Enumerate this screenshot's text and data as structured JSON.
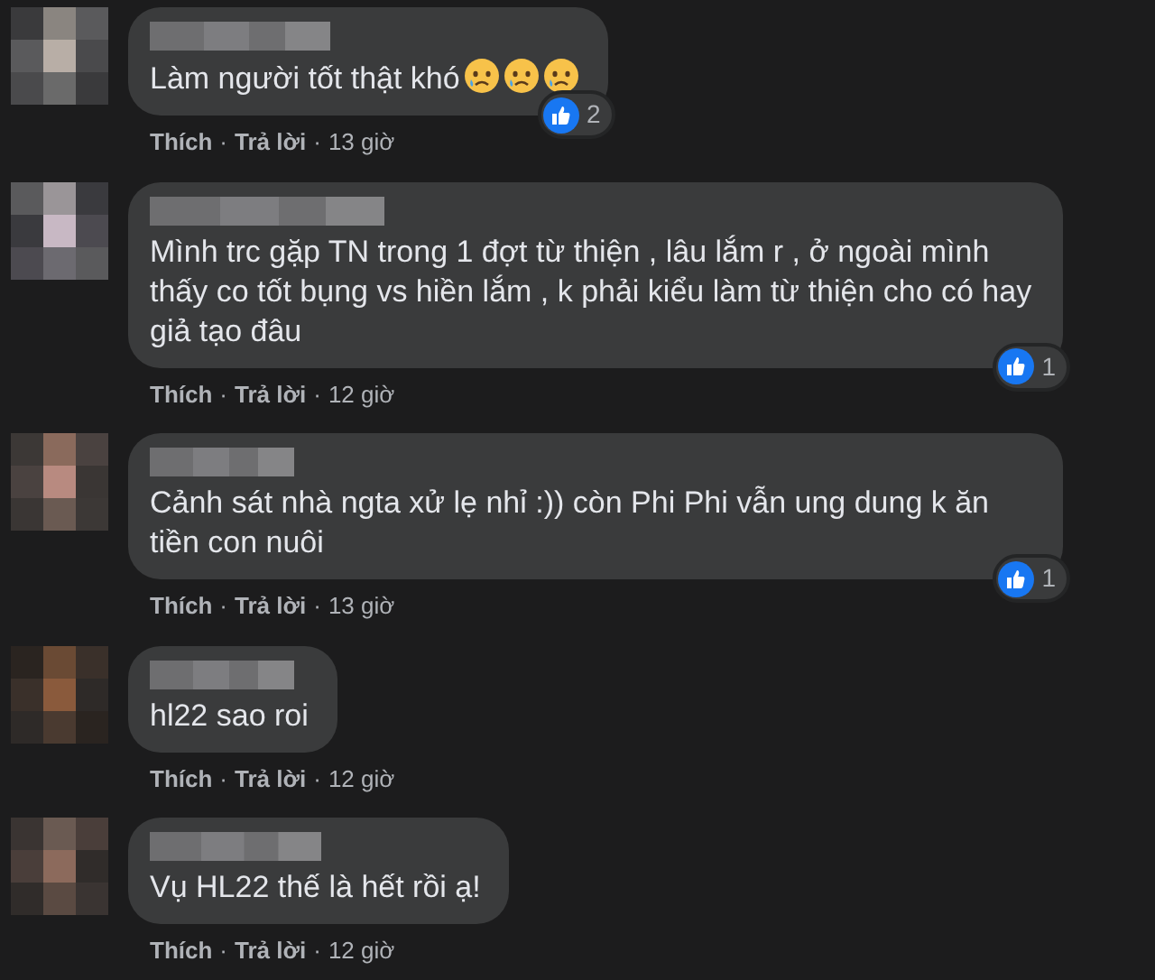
{
  "comments": [
    {
      "text": "Làm người tốt thật khó",
      "emojis": [
        {
          "kind": "crying"
        },
        {
          "kind": "crying"
        },
        {
          "kind": "crying"
        }
      ],
      "reactions": "2",
      "meta": [
        {
          "kind": "action",
          "text": "Thích"
        },
        {
          "kind": "dot",
          "text": "·"
        },
        {
          "kind": "action",
          "text": "Trả lời"
        },
        {
          "kind": "dot",
          "text": "·"
        },
        {
          "kind": "time",
          "text": "13 giờ"
        }
      ]
    },
    {
      "text": "Mình trc gặp TN trong 1 đợt từ thiện , lâu lắm r , ở ngoài mình thấy co tốt bụng vs hiền lắm , k phải kiểu làm từ thiện cho có hay giả tạo đâu",
      "reactions": "1",
      "meta": [
        {
          "kind": "action",
          "text": "Thích"
        },
        {
          "kind": "dot",
          "text": "·"
        },
        {
          "kind": "action",
          "text": "Trả lời"
        },
        {
          "kind": "dot",
          "text": "·"
        },
        {
          "kind": "time",
          "text": "12 giờ"
        }
      ]
    },
    {
      "text": "Cảnh sát nhà ngta xử lẹ nhỉ :)) còn Phi Phi vẫn ung dung k ăn tiền con nuôi",
      "reactions": "1",
      "meta": [
        {
          "kind": "action",
          "text": "Thích"
        },
        {
          "kind": "dot",
          "text": "·"
        },
        {
          "kind": "action",
          "text": "Trả lời"
        },
        {
          "kind": "dot",
          "text": "·"
        },
        {
          "kind": "time",
          "text": "13 giờ"
        }
      ]
    },
    {
      "text": "hl22 sao roi",
      "meta": [
        {
          "kind": "action",
          "text": "Thích"
        },
        {
          "kind": "dot",
          "text": "·"
        },
        {
          "kind": "action",
          "text": "Trả lời"
        },
        {
          "kind": "dot",
          "text": "·"
        },
        {
          "kind": "time",
          "text": "12 giờ"
        }
      ]
    },
    {
      "text": "Vụ HL22 thế là hết rồi ạ!",
      "meta": [
        {
          "kind": "action",
          "text": "Thích"
        },
        {
          "kind": "dot",
          "text": "·"
        },
        {
          "kind": "action",
          "text": "Trả lời"
        },
        {
          "kind": "dot",
          "text": "·"
        },
        {
          "kind": "time",
          "text": "12 giờ"
        }
      ]
    }
  ]
}
